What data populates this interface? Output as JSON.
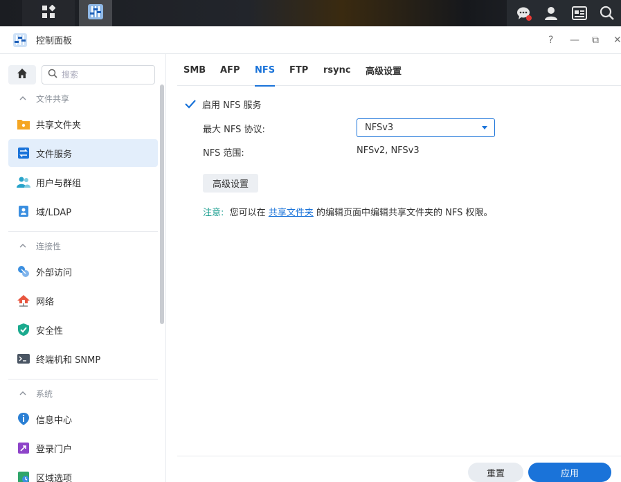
{
  "window": {
    "title": "控制面板",
    "help": "?",
    "minimize": "—",
    "restore": "⧉",
    "close": "✕"
  },
  "taskbar": {
    "grid_icon": "grid-icon",
    "app_icon": "control-panel-icon",
    "right_icons": [
      "chat-icon",
      "user-icon",
      "widgets-icon",
      "search-icon"
    ]
  },
  "sidebar": {
    "search_placeholder": "搜索",
    "sections": [
      {
        "label": "文件共享",
        "items": [
          "共享文件夹",
          "文件服务",
          "用户与群组",
          "域/LDAP"
        ]
      },
      {
        "label": "连接性",
        "items": [
          "外部访问",
          "网络",
          "安全性",
          "终端机和 SNMP"
        ]
      },
      {
        "label": "系统",
        "items": [
          "信息中心",
          "登录门户",
          "区域选项"
        ]
      }
    ],
    "active_item": "文件服务"
  },
  "tabs": [
    "SMB",
    "AFP",
    "NFS",
    "FTP",
    "rsync",
    "高级设置"
  ],
  "active_tab": "NFS",
  "nfs": {
    "enable_label": "启用 NFS 服务",
    "enabled": true,
    "max_protocol_label": "最大 NFS 协议:",
    "max_protocol_value": "NFSv3",
    "range_label": "NFS 范围:",
    "range_value": "NFSv2, NFSv3",
    "advanced_button": "高级设置",
    "note_prefix": "注意:",
    "note_before": "您可以在",
    "note_link": "共享文件夹",
    "note_after": "的编辑页面中编辑共享文件夹的 NFS 权限。"
  },
  "footer": {
    "reset": "重置",
    "apply": "应用"
  },
  "colors": {
    "accent": "#1a73d9",
    "note": "#1a9e8f",
    "active_bg": "#e3eefb"
  }
}
